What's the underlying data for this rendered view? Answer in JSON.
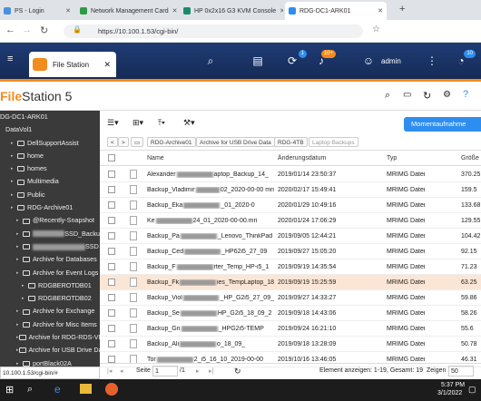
{
  "browser": {
    "tabs": [
      {
        "label": "PS - Login",
        "color": "#4a90e2"
      },
      {
        "label": "Network Management Card",
        "color": "#2e9a44"
      },
      {
        "label": "HP 0x2x16 G3 KVM Console",
        "color": "#1b8a6b"
      },
      {
        "label": "RDG-DC1-ARK01",
        "color": "#2e8ef0"
      }
    ],
    "url": "https://10.100.1.53/cgi-bin/"
  },
  "qnap": {
    "app_tab": "File Station",
    "badges": {
      "a": "1",
      "b": "10+",
      "c": "10"
    },
    "user": "admin"
  },
  "app": {
    "title_a": "File",
    "title_b": "Station 5"
  },
  "sidebar": {
    "items": [
      {
        "label": "DG-DC1-ARK01",
        "indent": 0
      },
      {
        "label": "DataVol1",
        "indent": 1
      },
      {
        "label": "DellSupportAssist",
        "indent": 2
      },
      {
        "label": "home",
        "indent": 2
      },
      {
        "label": "homes",
        "indent": 2
      },
      {
        "label": "Multimedia",
        "indent": 2
      },
      {
        "label": "Public",
        "indent": 2
      },
      {
        "label": "RDG-Archive01",
        "indent": 2
      },
      {
        "label": "@Recently-Snapshot",
        "indent": 3
      },
      {
        "label": "SSD_Backu",
        "indent": 3
      },
      {
        "label": "SSD",
        "indent": 3
      },
      {
        "label": "Archive for Databases",
        "indent": 3
      },
      {
        "label": "Archive for Event Logs",
        "indent": 3
      },
      {
        "label": "RDGBEROTDB01",
        "indent": 4
      },
      {
        "label": "RDGBEROTDB02",
        "indent": 4
      },
      {
        "label": "Archive for Exchange",
        "indent": 3
      },
      {
        "label": "Archive for Misc Items",
        "indent": 3
      },
      {
        "label": "Archive for RDG-RDS-VD",
        "indent": 3
      },
      {
        "label": "Archive for USB Drive Da",
        "indent": 3
      },
      {
        "label": "portBlack02A",
        "indent": 3
      }
    ]
  },
  "toolbar": {
    "snapshot": "Momentaufnahme"
  },
  "breadcrumb": [
    "RDG-Archive01",
    "Archive for USB Drive Data",
    "RDG-4TB",
    "Laptop Backups"
  ],
  "table": {
    "headers": [
      "Name",
      "Änderungsdatum",
      "Typ",
      "Größe"
    ],
    "rows": [
      {
        "name": "Alexander",
        "name2": "aptop_Backup_14_",
        "date": "2019/01/14 23:50:37",
        "type": "MRIMG Datei",
        "size": "370.25"
      },
      {
        "name": "Backup_Vladimir",
        "name2": "02_2020-00-00 mri",
        "date": "2020/02/17 15:49:41",
        "type": "MRIMG Datei",
        "size": "159.5"
      },
      {
        "name": "Backup_Eka",
        "name2": "_01_2020-0",
        "date": "2020/01/29 10:49:16",
        "type": "MRIMG Datei",
        "size": "133.68"
      },
      {
        "name": "Ke",
        "name2": "24_01_2020-00-00.mri",
        "date": "2020/01/24 17:06:29",
        "type": "MRIMG Datei",
        "size": "129.55"
      },
      {
        "name": "Backup_Pa",
        "name2": "_Lenovo_ThinkPad",
        "date": "2019/09/05 12:44:21",
        "type": "MRIMG Datei",
        "size": "104.42"
      },
      {
        "name": "Backup_Ced",
        "name2": "_HP62i5_27_09",
        "date": "2019/09/27 15:05:20",
        "type": "MRIMG Datei",
        "size": "92.15"
      },
      {
        "name": "Backup_F",
        "name2": "rter_Temp_HP-i5_1",
        "date": "2019/09/19 14:35:54",
        "type": "MRIMG Datei",
        "size": "71.23"
      },
      {
        "name": "Backup_Fk",
        "name2": "ies_TempLaptop_18",
        "date": "2019/09/19 15:25:59",
        "type": "MRIMG Datei",
        "size": "63.25",
        "selected": true
      },
      {
        "name": "Backup_Viol",
        "name2": "_HP_G2i5_27_09_",
        "date": "2019/09/27 14:33:27",
        "type": "MRIMG Datei",
        "size": "59.86"
      },
      {
        "name": "Backup_Se",
        "name2": "HP_G2i5_18_09_2",
        "date": "2019/09/18 14:43:06",
        "type": "MRIMG Datei",
        "size": "58.26"
      },
      {
        "name": "Backup_Gn",
        "name2": "_HPG2i5-TEMP",
        "date": "2019/09/24 16:21:10",
        "type": "MRIMG Datei",
        "size": "55.6"
      },
      {
        "name": "Backup_Ali",
        "name2": "o_18_09_",
        "date": "2019/09/18 13:28:09",
        "type": "MRIMG Datei",
        "size": "50.78"
      },
      {
        "name": "Tor",
        "name2": "2_i5_16_10_2019-00-00",
        "date": "2019/10/16 13:46:05",
        "type": "MRIMG Datei",
        "size": "46.31"
      }
    ]
  },
  "footer": {
    "page_label": "Seite",
    "page": "1",
    "of": "/1",
    "items": "Element anzeigen: 1-19, Gesamt: 19",
    "show": "Zeigen",
    "per_page": "50"
  },
  "status_url": "10.100.1.53/cgi-bin/#",
  "taskbar": {
    "time": "5:37 PM",
    "date": "3/1/2022"
  }
}
